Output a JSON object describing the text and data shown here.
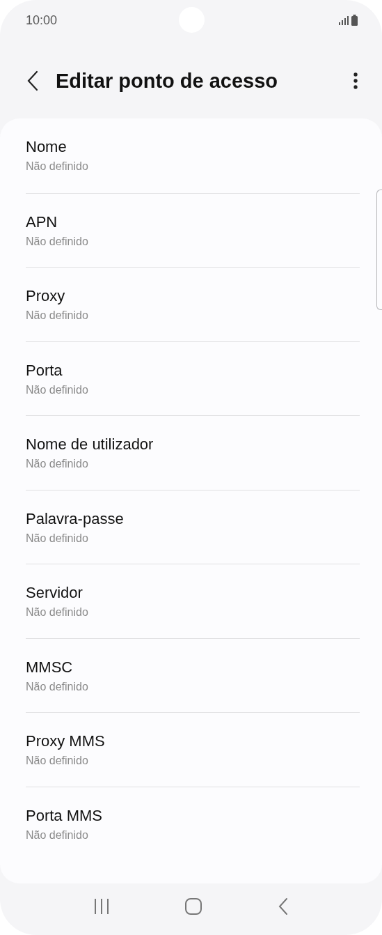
{
  "status_bar": {
    "time": "10:00"
  },
  "header": {
    "title": "Editar ponto de acesso"
  },
  "settings": [
    {
      "title": "Nome",
      "value": "Não definido"
    },
    {
      "title": "APN",
      "value": "Não definido"
    },
    {
      "title": "Proxy",
      "value": "Não definido"
    },
    {
      "title": "Porta",
      "value": "Não definido"
    },
    {
      "title": "Nome de utilizador",
      "value": "Não definido"
    },
    {
      "title": "Palavra-passe",
      "value": "Não definido"
    },
    {
      "title": "Servidor",
      "value": "Não definido"
    },
    {
      "title": "MMSC",
      "value": "Não definido"
    },
    {
      "title": "Proxy MMS",
      "value": "Não definido"
    },
    {
      "title": "Porta MMS",
      "value": "Não definido"
    }
  ]
}
